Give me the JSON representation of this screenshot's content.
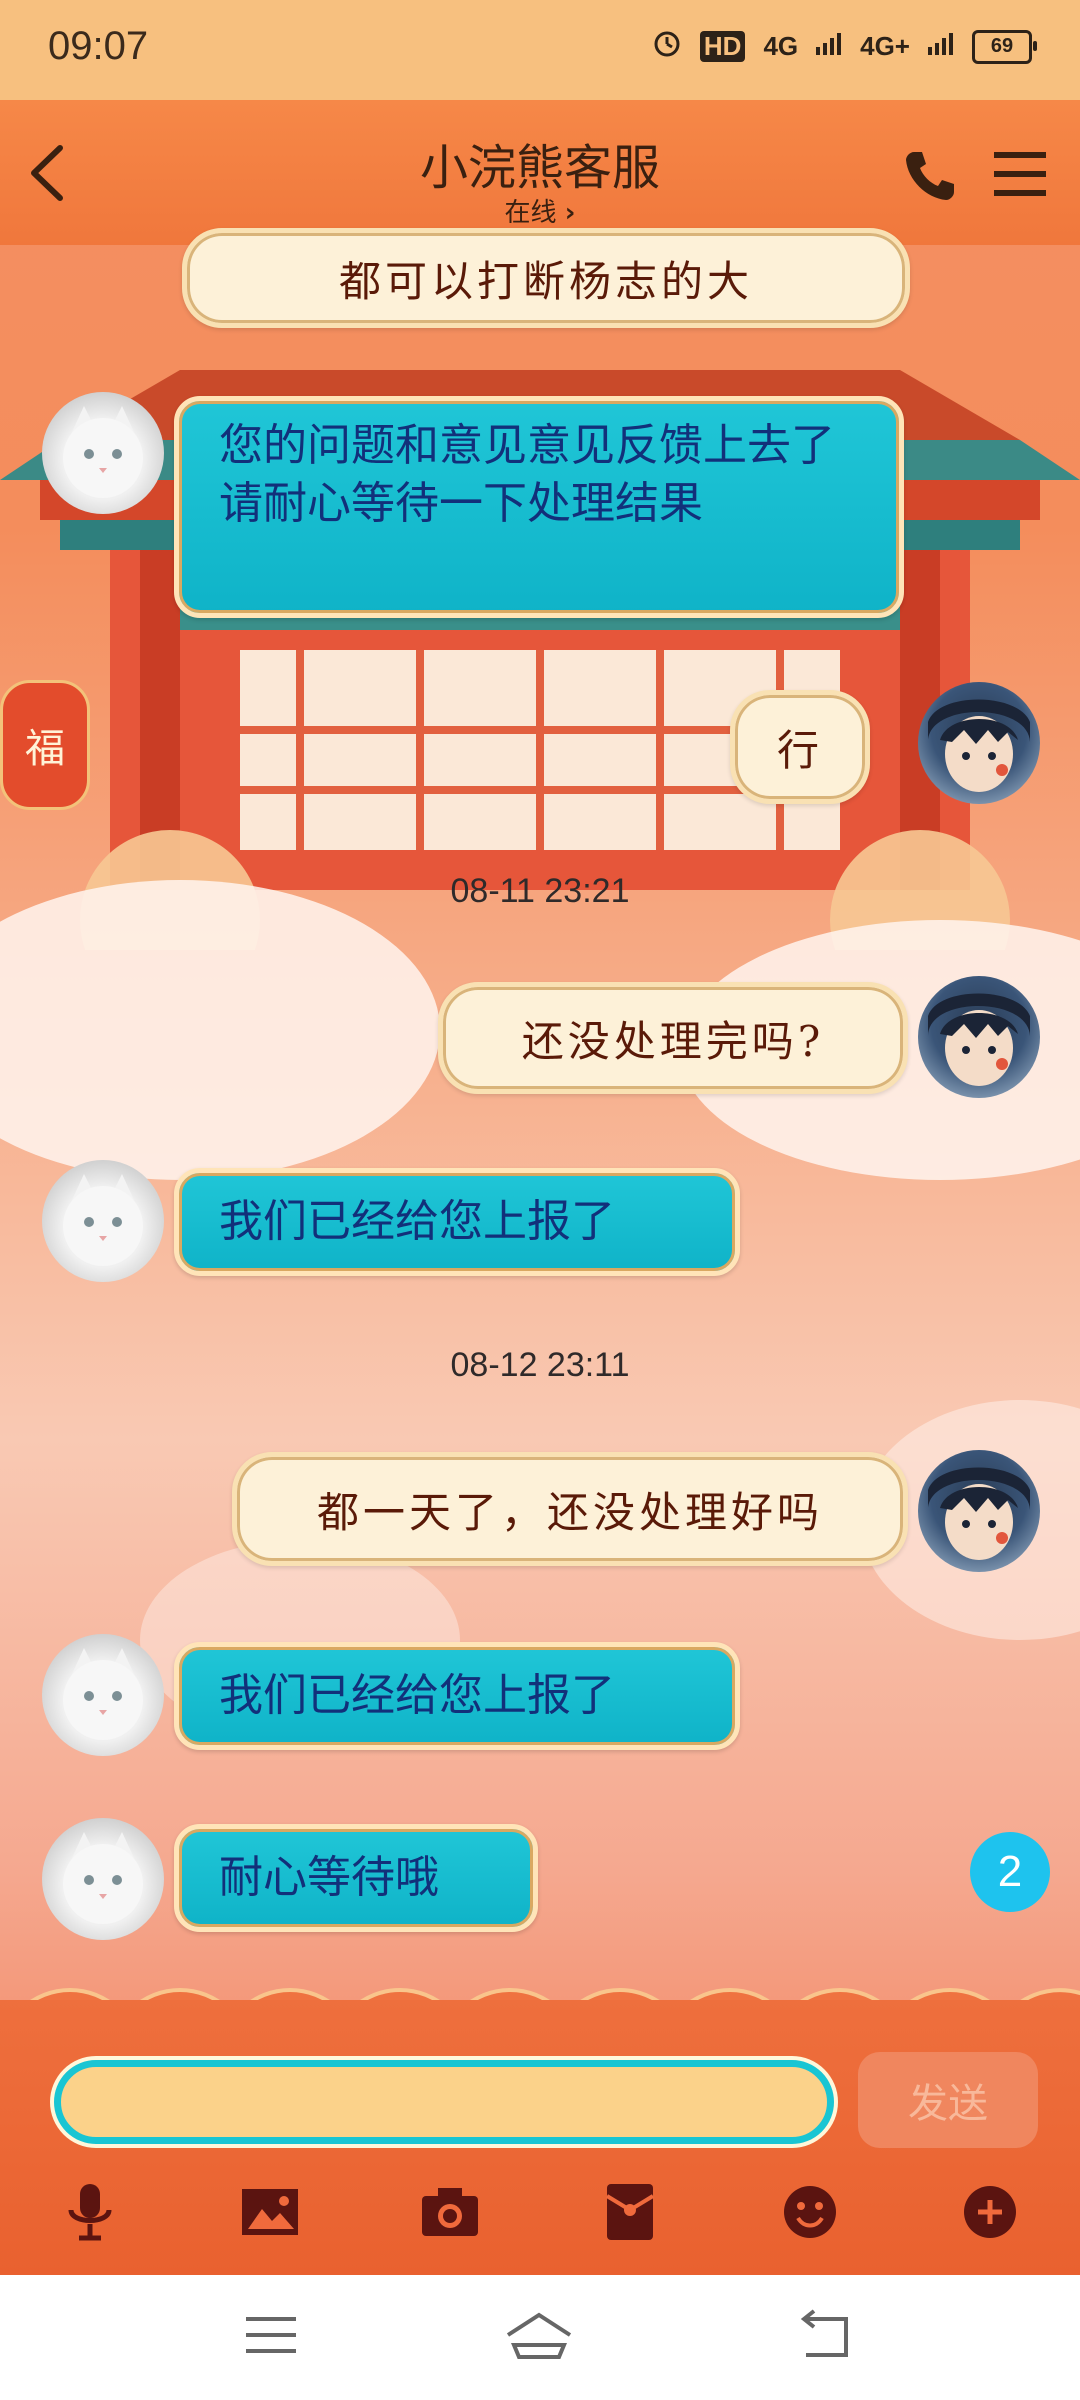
{
  "status_bar": {
    "time": "09:07",
    "hd": "HD",
    "network1": "4G",
    "network2": "4G+",
    "battery": "69"
  },
  "header": {
    "title": "小浣熊客服",
    "status": "在线"
  },
  "messages": [
    {
      "sender": "user",
      "text": "都可以打断杨志的大"
    },
    {
      "sender": "agent",
      "text": "您的问题和意见意见反馈上去了 请耐心等待一下处理结果"
    },
    {
      "sender": "user",
      "text": "行"
    },
    {
      "sender": "timestamp",
      "text": "08-11 23:21"
    },
    {
      "sender": "user",
      "text": "还没处理完吗?"
    },
    {
      "sender": "agent",
      "text": "我们已经给您上报了"
    },
    {
      "sender": "timestamp",
      "text": "08-12 23:11"
    },
    {
      "sender": "user",
      "text": "都一天了，还没处理好吗"
    },
    {
      "sender": "agent",
      "text": "我们已经给您上报了"
    },
    {
      "sender": "agent",
      "text": "耐心等待哦"
    }
  ],
  "unread_count": "2",
  "composer": {
    "placeholder": "",
    "send_label": "发送"
  },
  "decor": {
    "lantern_char": "福"
  },
  "toolbar_icons": [
    "microphone-icon",
    "image-icon",
    "camera-icon",
    "red-packet-icon",
    "emoji-icon",
    "plus-icon"
  ],
  "colors": {
    "agent_bubble": "#14b8cc",
    "user_bubble": "#fdf1d8",
    "header": "#f0773c",
    "input_border": "#19c5d3"
  }
}
